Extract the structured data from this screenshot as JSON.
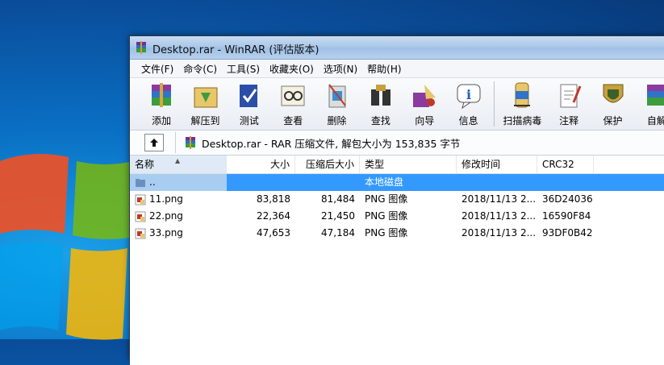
{
  "window": {
    "title": "Desktop.rar - WinRAR (评估版本)"
  },
  "menu": [
    "文件(F)",
    "命令(C)",
    "工具(S)",
    "收藏夹(O)",
    "选项(N)",
    "帮助(H)"
  ],
  "toolbar": [
    {
      "label": "添加",
      "icon": "add-icon"
    },
    {
      "label": "解压到",
      "icon": "extract-icon"
    },
    {
      "label": "测试",
      "icon": "test-icon"
    },
    {
      "label": "查看",
      "icon": "view-icon"
    },
    {
      "label": "删除",
      "icon": "delete-icon"
    },
    {
      "label": "查找",
      "icon": "find-icon"
    },
    {
      "label": "向导",
      "icon": "wizard-icon"
    },
    {
      "label": "信息",
      "icon": "info-icon"
    },
    {
      "label": "扫描病毒",
      "icon": "virus-scan-icon"
    },
    {
      "label": "注释",
      "icon": "comment-icon"
    },
    {
      "label": "保护",
      "icon": "protect-icon"
    },
    {
      "label": "自解",
      "icon": "sfx-icon"
    }
  ],
  "address": {
    "text": "Desktop.rar - RAR 压缩文件, 解包大小为 153,835 字节"
  },
  "columns": {
    "name": "名称",
    "size": "大小",
    "packed": "压缩后大小",
    "type": "类型",
    "modified": "修改时间",
    "crc": "CRC32"
  },
  "rows": [
    {
      "name": "..",
      "size": "",
      "packed": "",
      "type": "本地磁盘",
      "modified": "",
      "crc": ""
    },
    {
      "name": "11.png",
      "size": "83,818",
      "packed": "81,484",
      "type": "PNG 图像",
      "modified": "2018/11/13 2...",
      "crc": "36D24036"
    },
    {
      "name": "22.png",
      "size": "22,364",
      "packed": "21,450",
      "type": "PNG 图像",
      "modified": "2018/11/13 2...",
      "crc": "16590F84"
    },
    {
      "name": "33.png",
      "size": "47,653",
      "packed": "47,184",
      "type": "PNG 图像",
      "modified": "2018/11/13 2...",
      "crc": "93DF0B42"
    }
  ]
}
